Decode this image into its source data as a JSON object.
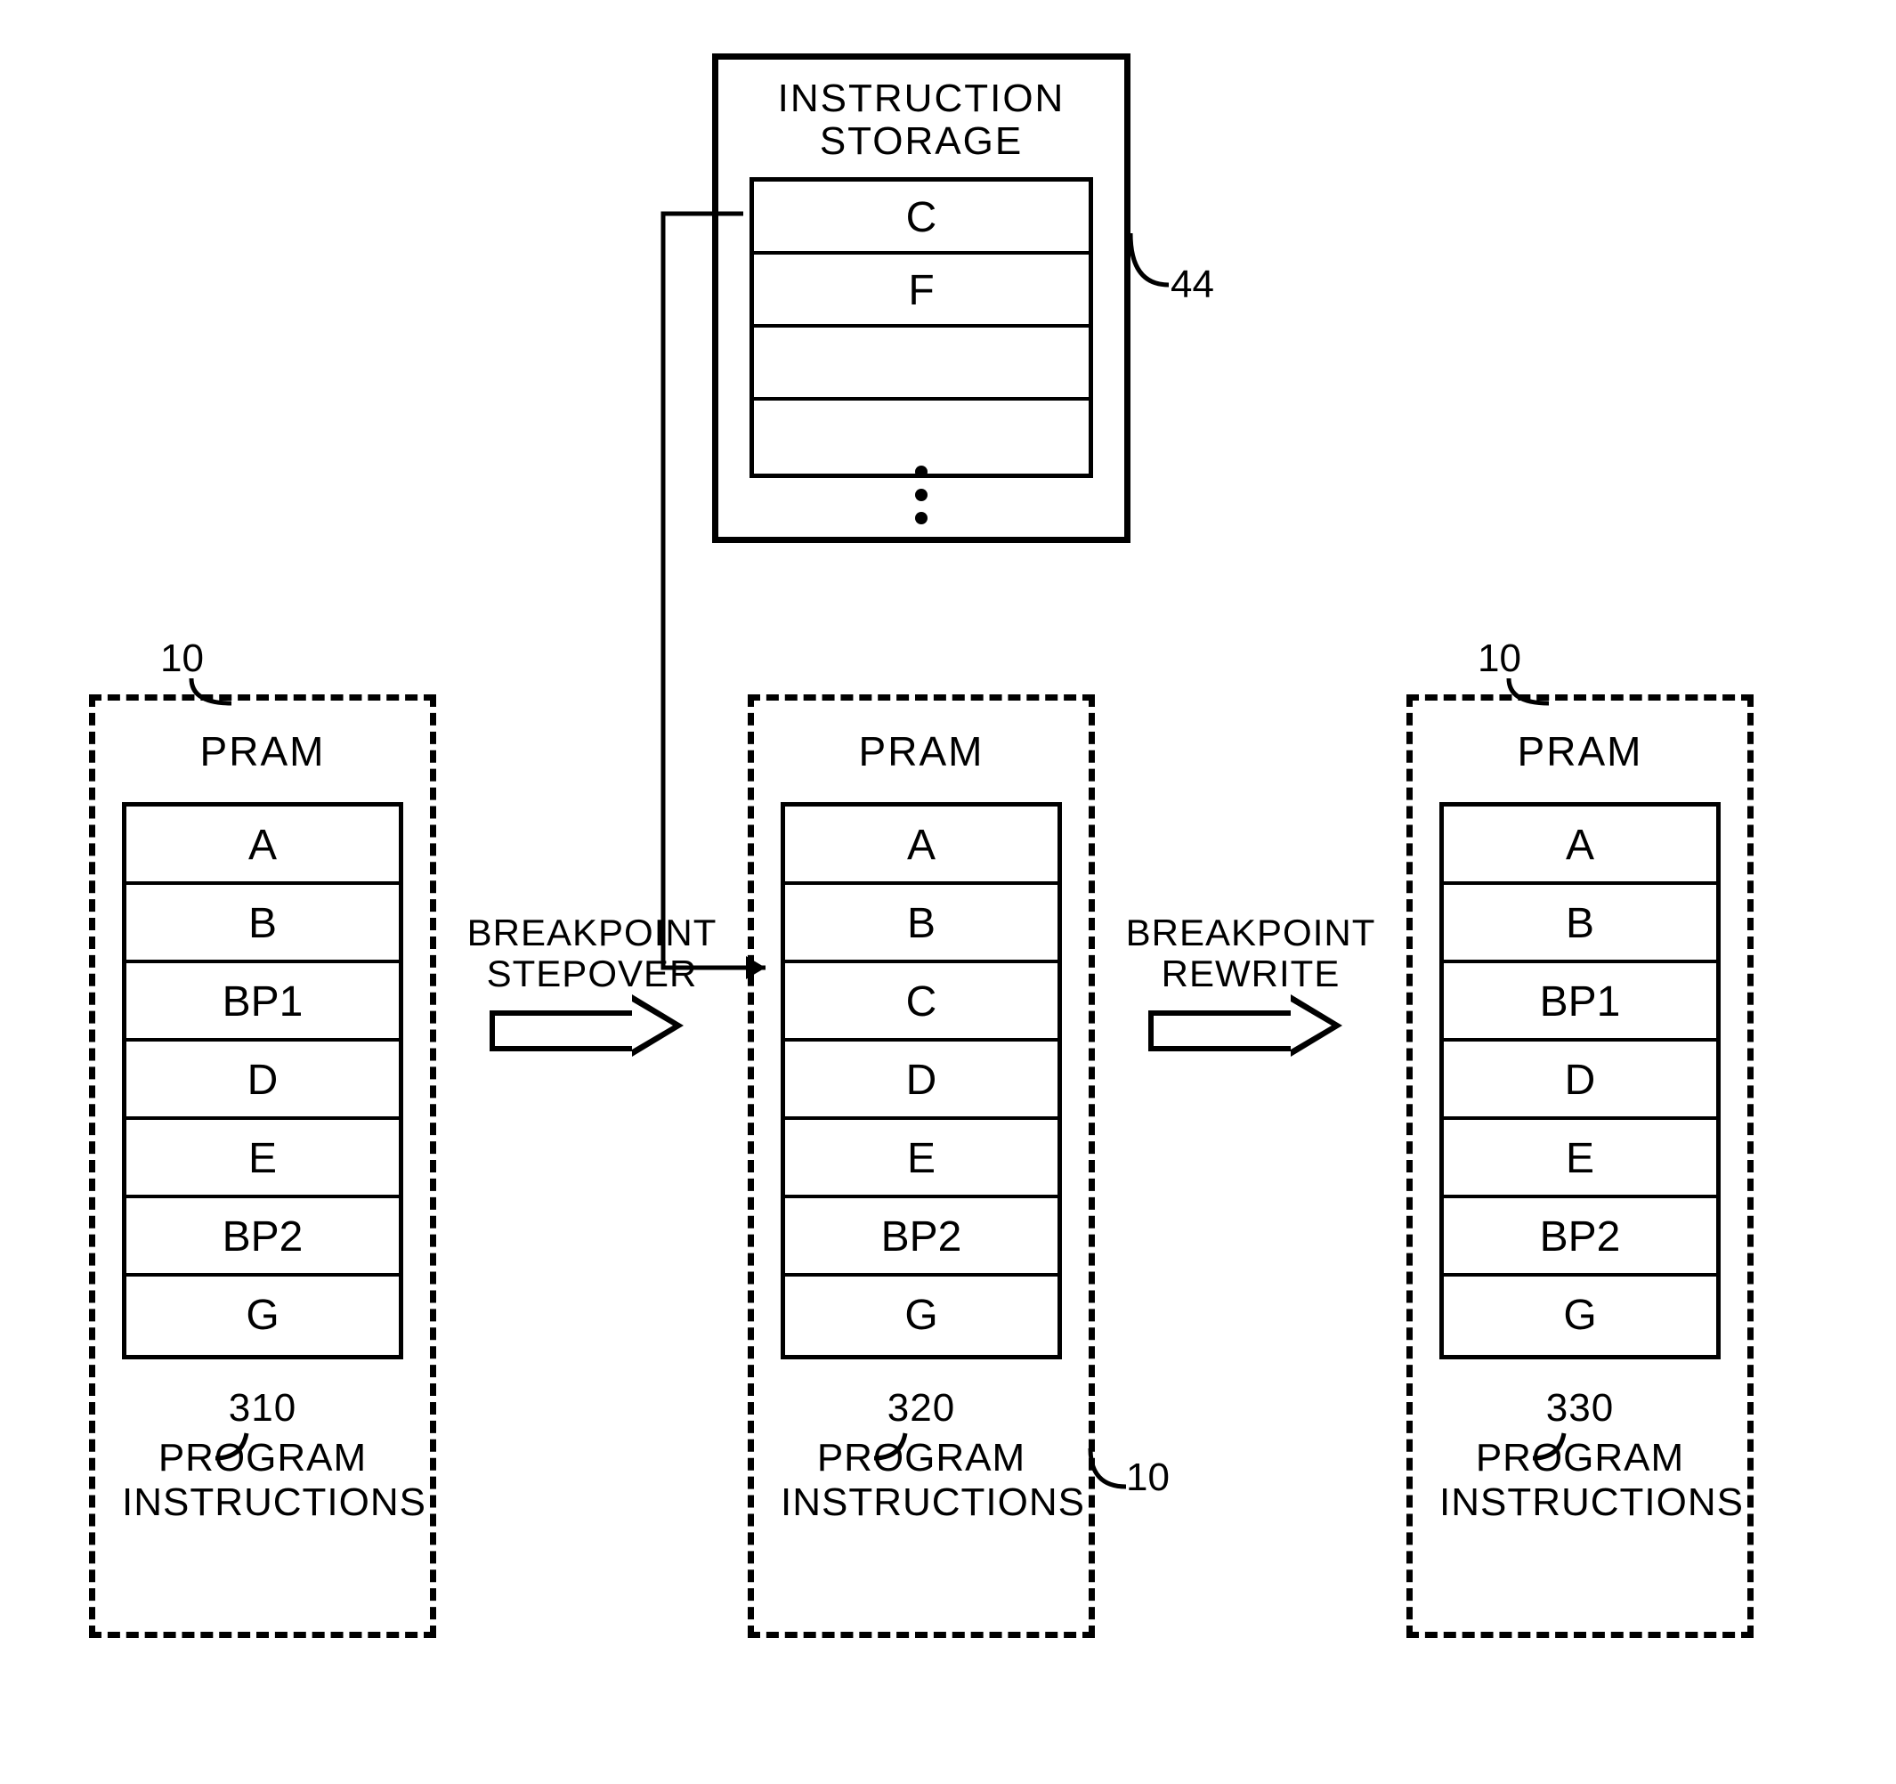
{
  "instruction_storage": {
    "title": "INSTRUCTION\nSTORAGE",
    "ref": "44",
    "cells": [
      "C",
      "F",
      "",
      ""
    ]
  },
  "pram_ref": "10",
  "pram": {
    "title": "PRAM",
    "states": [
      {
        "num": "310",
        "caption": "PROGRAM INSTRUCTIONS",
        "cells": [
          "A",
          "B",
          "BP1",
          "D",
          "E",
          "BP2",
          "G"
        ]
      },
      {
        "num": "320",
        "caption": "PROGRAM INSTRUCTIONS",
        "cells": [
          "A",
          "B",
          "C",
          "D",
          "E",
          "BP2",
          "G"
        ]
      },
      {
        "num": "330",
        "caption": "PROGRAM INSTRUCTIONS",
        "cells": [
          "A",
          "B",
          "BP1",
          "D",
          "E",
          "BP2",
          "G"
        ]
      }
    ]
  },
  "transitions": [
    "BREAKPOINT STEPOVER",
    "BREAKPOINT REWRITE"
  ]
}
